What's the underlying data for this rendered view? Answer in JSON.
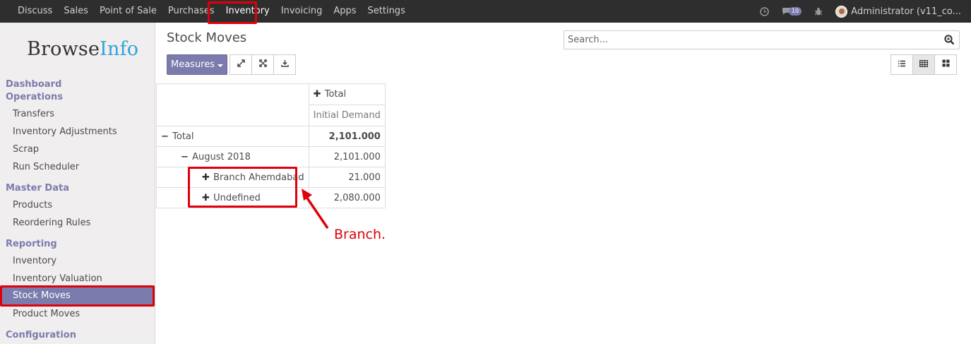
{
  "topbar": {
    "menu": [
      "Discuss",
      "Sales",
      "Point of Sale",
      "Purchases",
      "Inventory",
      "Invoicing",
      "Apps",
      "Settings"
    ],
    "active": "Inventory",
    "message_count": "10",
    "user": "Administrator (v11_co..."
  },
  "sidebar": {
    "logo_browse": "Browse",
    "logo_info": "Info",
    "dashboard": "Dashboard",
    "operations": "Operations",
    "operations_items": [
      "Transfers",
      "Inventory Adjustments",
      "Scrap",
      "Run Scheduler"
    ],
    "master_data": "Master Data",
    "master_items": [
      "Products",
      "Reordering Rules"
    ],
    "reporting": "Reporting",
    "reporting_items": [
      "Inventory",
      "Inventory Valuation",
      "Stock Moves",
      "Product Moves"
    ],
    "active_item": "Stock Moves",
    "configuration": "Configuration"
  },
  "main": {
    "title": "Stock Moves",
    "search_placeholder": "Search...",
    "measures_label": "Measures"
  },
  "pivot": {
    "col_header": "Total",
    "measure": "Initial Demand",
    "rows": [
      {
        "label": "Total",
        "value": "2,101.000",
        "sign": "minus"
      },
      {
        "label": "August 2018",
        "value": "2,101.000",
        "sign": "minus"
      },
      {
        "label": "Branch Ahemdabad",
        "value": "21.000",
        "sign": "plus"
      },
      {
        "label": "Undefined",
        "value": "2,080.000",
        "sign": "plus"
      }
    ]
  },
  "annotation": {
    "text": "Branch.",
    "color": "#e0000b"
  },
  "colors": {
    "brand": "#7c7bad",
    "navbar": "#2e2e2e",
    "logo_accent": "#2fa3da"
  }
}
